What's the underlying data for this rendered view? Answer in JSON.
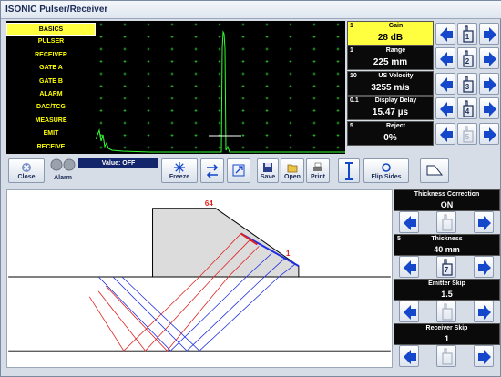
{
  "window": {
    "title": "ISONIC Pulser/Receiver"
  },
  "menu": {
    "items": [
      {
        "label": "BASICS",
        "active": true
      },
      {
        "label": "PULSER"
      },
      {
        "label": "RECEIVER"
      },
      {
        "label": "GATE A"
      },
      {
        "label": "GATE B"
      },
      {
        "label": "ALARM"
      },
      {
        "label": "DAC/TCG"
      },
      {
        "label": "MEASURE"
      },
      {
        "label": "EMIT"
      },
      {
        "label": "RECEIVE"
      }
    ]
  },
  "params": [
    {
      "index": "1",
      "title": "Gain",
      "value": "28 dB",
      "active": true,
      "button_digit": "1"
    },
    {
      "index": "1",
      "title": "Range",
      "value": "225 mm",
      "button_digit": "2"
    },
    {
      "index": "10",
      "title": "US Velocity",
      "value": "3255 m/s",
      "button_digit": "3"
    },
    {
      "index": "0.1",
      "title": "Display Delay",
      "value": "15.47 µs",
      "button_digit": "4"
    },
    {
      "index": "5",
      "title": "Reject",
      "value": "0%",
      "button_digit": "5"
    }
  ],
  "toolbar": {
    "close_label": "Close",
    "alarm_label": "Alarm",
    "value_text": "Value: OFF",
    "freeze_label": "Freeze",
    "save_label": "Save",
    "open_label": "Open",
    "print_label": "Print",
    "flip_label": "Flip Sides"
  },
  "diagram": {
    "label_top": "64",
    "label_right": "1"
  },
  "right_panel": [
    {
      "title": "Thickness Correction",
      "value": "ON",
      "index": ""
    },
    {
      "title": "Thickness",
      "value": "40 mm",
      "index": "5",
      "button_digit": "7"
    },
    {
      "title": "Emitter Skip",
      "value": "1.5",
      "index": ""
    },
    {
      "title": "Receiver Skip",
      "value": "1",
      "index": ""
    }
  ],
  "colors": {
    "accent_yellow": "#ffff40",
    "arrow_blue": "#1447c9",
    "scope_green": "#33ff33",
    "red_ray": "#e02020",
    "blue_ray": "#2030e0"
  }
}
